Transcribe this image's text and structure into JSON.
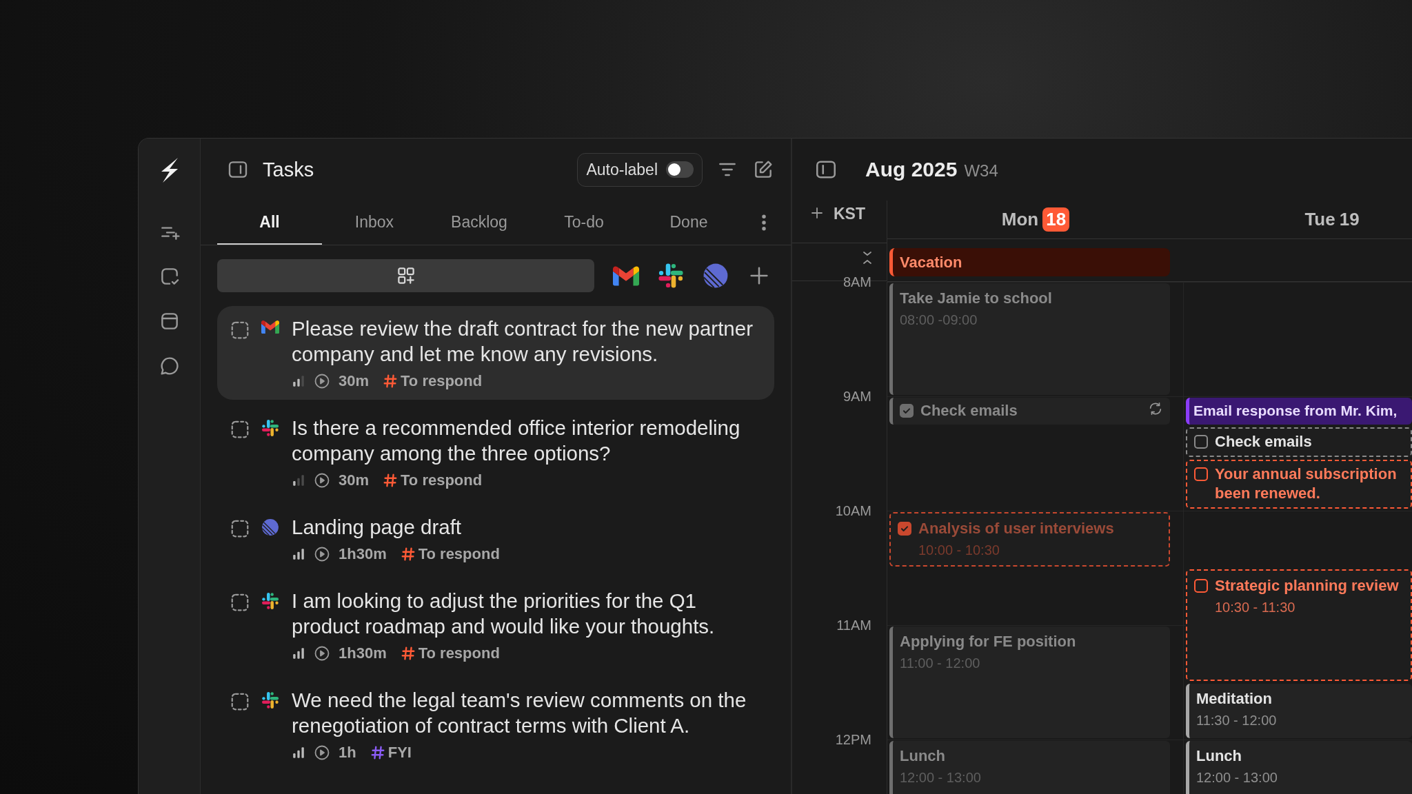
{
  "tasks_panel": {
    "title": "Tasks",
    "auto_label": {
      "label": "Auto-label",
      "on": false
    },
    "tabs": [
      {
        "label": "All",
        "selected": true
      },
      {
        "label": "Inbox",
        "selected": false
      },
      {
        "label": "Backlog",
        "selected": false
      },
      {
        "label": "To-do",
        "selected": false
      },
      {
        "label": "Done",
        "selected": false
      }
    ],
    "sources": [
      {
        "kind": "gmail"
      },
      {
        "kind": "slack"
      },
      {
        "kind": "linear"
      }
    ],
    "items": [
      {
        "source": {
          "kind": "gmail"
        },
        "title": "Please review the draft contract for the new partner company and let me know any revisions.",
        "priority": {
          "kind": "medium"
        },
        "duration": "30m",
        "tag": {
          "label": "To respond",
          "color": "#ff5a36"
        },
        "selected": true
      },
      {
        "source": {
          "kind": "slack"
        },
        "title": "Is there a recommended office interior remodeling company among the three options?",
        "priority": {
          "kind": "low"
        },
        "duration": "30m",
        "tag": {
          "label": "To respond",
          "color": "#ff5a36"
        },
        "selected": false
      },
      {
        "source": {
          "kind": "linear"
        },
        "title": "Landing page draft",
        "priority": {
          "kind": "high"
        },
        "duration": "1h30m",
        "tag": {
          "label": "To respond",
          "color": "#ff5a36"
        },
        "selected": false
      },
      {
        "source": {
          "kind": "slack"
        },
        "title": "I am looking to adjust the priorities for the Q1 product roadmap and would like your thoughts.",
        "priority": {
          "kind": "high"
        },
        "duration": "1h30m",
        "tag": {
          "label": "To respond",
          "color": "#ff5a36"
        },
        "selected": false
      },
      {
        "source": {
          "kind": "slack"
        },
        "title": "We need the legal team's review comments on the renegotiation of contract terms with Client A.",
        "priority": {
          "kind": "high"
        },
        "duration": "1h",
        "tag": {
          "label": "FYI",
          "color": "#8b5cf6"
        },
        "selected": false
      }
    ]
  },
  "calendar": {
    "month": "Aug 2025",
    "week": "W34",
    "timezone": "KST",
    "hours": [
      {
        "label": "8AM"
      },
      {
        "label": "9AM",
        "stacks": [
          {
            "events": [
              {
                "kind": "event",
                "title": "Check emails",
                "color": "#6e6e6e",
                "faded": true,
                "checked": true,
                "recurring": true
              }
            ]
          },
          {
            "events": [
              {
                "kind": "banner",
                "title": "Email response from Mr. Kim,",
                "color": "#8b3cf7",
                "faded": false
              },
              {
                "kind": "task",
                "title": "Check emails",
                "color": "#8a8a8a",
                "faded": false,
                "checked": false
              },
              {
                "kind": "alert",
                "title": "Your annual subscription\nbeen renewed.",
                "color": "#ff5a36",
                "faded": false,
                "checked": false
              }
            ]
          }
        ]
      },
      {
        "label": "10AM"
      },
      {
        "label": "11AM"
      },
      {
        "label": "12PM"
      }
    ],
    "days": [
      {
        "name": "Mon",
        "date": "18",
        "today": true,
        "all_day": [
          {
            "title": "Vacation",
            "color": "#ff5a36"
          }
        ],
        "events": [
          {
            "kind": "event",
            "title": "Take Jamie to school",
            "time": "08:00 -09:00",
            "color": "#6e6e6e",
            "faded": true
          },
          {
            "kind": "alert",
            "title": "Analysis of user interviews",
            "time": "10:00 - 10:30",
            "color": "#c9482e",
            "faded": true,
            "checked": true
          },
          {
            "kind": "event",
            "title": "Applying for FE position",
            "time": "11:00 - 12:00",
            "color": "#6e6e6e",
            "faded": true
          },
          {
            "kind": "event",
            "title": "Lunch",
            "time": "12:00 - 13:00",
            "color": "#6e6e6e",
            "faded": true
          }
        ]
      },
      {
        "name": "Tue",
        "date": "19",
        "today": false,
        "events": [
          {
            "kind": "alert",
            "title": "Strategic planning review",
            "time": "10:30 - 11:30",
            "color": "#ff5a36",
            "faded": false,
            "checked": false
          },
          {
            "kind": "event",
            "title": "Meditation",
            "time": "11:30 - 12:00",
            "color": "#a8a8a8",
            "faded": false
          },
          {
            "kind": "event",
            "title": "Lunch",
            "time": "12:00 - 13:00",
            "color": "#a8a8a8",
            "faded": false
          }
        ]
      }
    ]
  }
}
